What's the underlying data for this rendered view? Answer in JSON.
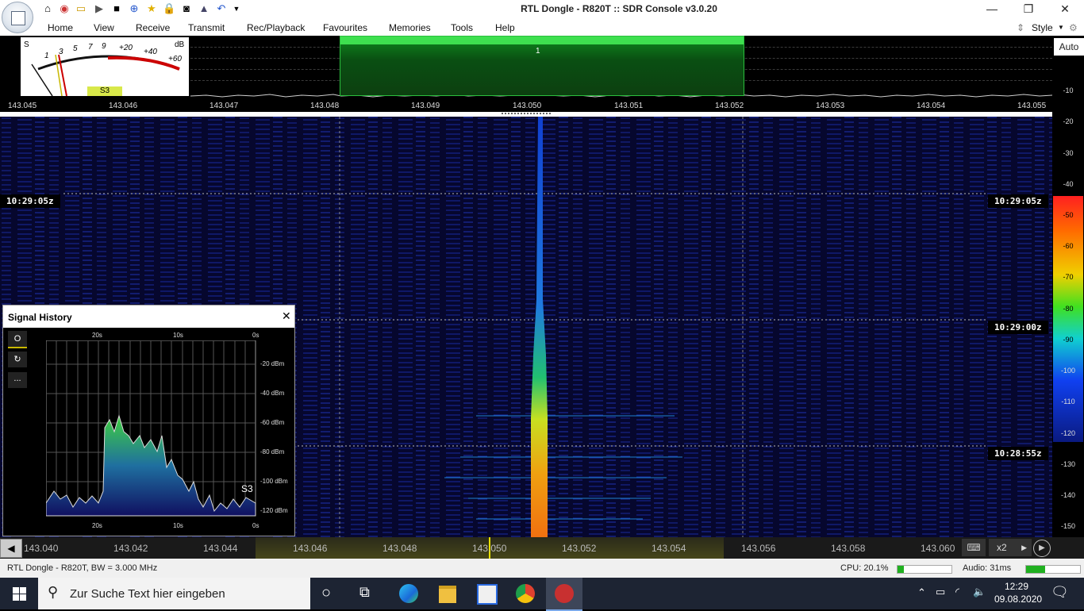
{
  "window": {
    "title": "RTL Dongle - R820T :: SDR Console v3.0.20"
  },
  "menu": [
    "Home",
    "View",
    "Receive",
    "Transmit",
    "Rec/Playback",
    "Favourites",
    "Memories",
    "Tools",
    "Help"
  ],
  "style_label": "Style",
  "spectrum": {
    "freq_labels": [
      "143.045",
      "143.046",
      "143.047",
      "143.048",
      "143.049",
      "143.050",
      "143.051",
      "143.052",
      "143.053",
      "143.054",
      "143.055"
    ],
    "filter_number": "1",
    "smeter": {
      "s_label": "S",
      "db_label": "dB",
      "ticks": [
        "1",
        "3",
        "5",
        "7",
        "9",
        "+20",
        "+40",
        "+60"
      ],
      "reading": "S3"
    }
  },
  "scale": {
    "auto_label": "Auto",
    "db_ticks": [
      "-10",
      "-20",
      "-30",
      "-40",
      "-50",
      "-60",
      "-70",
      "-80",
      "-90",
      "-100",
      "-110",
      "-120",
      "-130",
      "-140",
      "-150"
    ]
  },
  "waterfall": {
    "timestamps": [
      "10:29:05z",
      "10:29:00z",
      "10:28:55z"
    ]
  },
  "signal_history": {
    "title": "Signal History",
    "time_labels": [
      "20s",
      "10s",
      "0s"
    ],
    "dbm_labels": [
      "-20 dBm",
      "-40 dBm",
      "-60 dBm",
      "-80 dBm",
      "-100 dBm",
      "-120 dBm"
    ],
    "reading": "S3",
    "side_buttons": [
      "O",
      "↻",
      "..."
    ]
  },
  "bottom_freq": {
    "labels": [
      "143.040",
      "143.042",
      "143.044",
      "143.046",
      "143.048",
      "143.050",
      "143.052",
      "143.054",
      "143.056",
      "143.058",
      "143.060"
    ],
    "zoom": "x2"
  },
  "status": {
    "device": "RTL Dongle - R820T, BW = 3.000 MHz",
    "cpu": "CPU: 20.1%",
    "audio": "Audio: 31ms",
    "cpu_level": 0.12,
    "audio_level": 0.35
  },
  "taskbar": {
    "search_placeholder": "Zur Suche Text hier eingeben",
    "time": "12:29",
    "date": "09.08.2020"
  }
}
